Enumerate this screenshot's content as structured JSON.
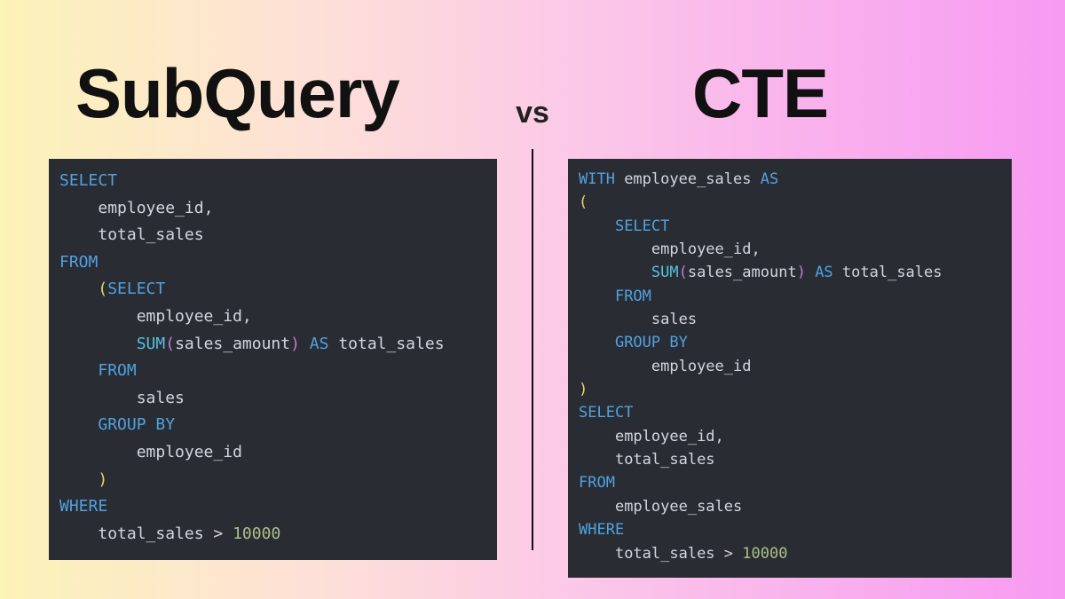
{
  "titles": {
    "left": "SubQuery",
    "right": "CTE",
    "vs": "vs"
  },
  "code": {
    "subquery": {
      "lines": [
        [
          {
            "c": "kw",
            "t": "SELECT"
          }
        ],
        [
          {
            "c": "guide",
            "t": "    "
          },
          {
            "c": "ident",
            "t": "employee_id,"
          }
        ],
        [
          {
            "c": "guide",
            "t": "    "
          },
          {
            "c": "ident",
            "t": "total_sales"
          }
        ],
        [
          {
            "c": "kw",
            "t": "FROM"
          }
        ],
        [
          {
            "c": "guide",
            "t": "    "
          },
          {
            "c": "paren-y",
            "t": "("
          },
          {
            "c": "kw",
            "t": "SELECT"
          }
        ],
        [
          {
            "c": "guide",
            "t": "        "
          },
          {
            "c": "ident",
            "t": "employee_id,"
          }
        ],
        [
          {
            "c": "guide",
            "t": "        "
          },
          {
            "c": "func",
            "t": "SUM"
          },
          {
            "c": "paren-p",
            "t": "("
          },
          {
            "c": "ident",
            "t": "sales_amount"
          },
          {
            "c": "paren-p",
            "t": ")"
          },
          {
            "c": "ident",
            "t": " "
          },
          {
            "c": "kw",
            "t": "AS"
          },
          {
            "c": "ident",
            "t": " total_sales"
          }
        ],
        [
          {
            "c": "guide",
            "t": "    "
          },
          {
            "c": "kw",
            "t": "FROM"
          }
        ],
        [
          {
            "c": "guide",
            "t": "        "
          },
          {
            "c": "ident",
            "t": "sales"
          }
        ],
        [
          {
            "c": "guide",
            "t": "    "
          },
          {
            "c": "kw",
            "t": "GROUP BY"
          }
        ],
        [
          {
            "c": "guide",
            "t": "        "
          },
          {
            "c": "ident",
            "t": "employee_id"
          }
        ],
        [
          {
            "c": "guide",
            "t": "    "
          },
          {
            "c": "paren-y",
            "t": ")"
          }
        ],
        [
          {
            "c": "kw",
            "t": "WHERE"
          }
        ],
        [
          {
            "c": "guide",
            "t": "    "
          },
          {
            "c": "ident",
            "t": "total_sales "
          },
          {
            "c": "op",
            "t": ">"
          },
          {
            "c": "ident",
            "t": " "
          },
          {
            "c": "num",
            "t": "10000"
          }
        ]
      ]
    },
    "cte": {
      "lines": [
        [
          {
            "c": "kw",
            "t": "WITH"
          },
          {
            "c": "ident",
            "t": " employee_sales "
          },
          {
            "c": "kw",
            "t": "AS"
          }
        ],
        [
          {
            "c": "paren-y",
            "t": "("
          }
        ],
        [
          {
            "c": "guide",
            "t": "    "
          },
          {
            "c": "kw",
            "t": "SELECT"
          }
        ],
        [
          {
            "c": "guide",
            "t": "        "
          },
          {
            "c": "ident",
            "t": "employee_id,"
          }
        ],
        [
          {
            "c": "guide",
            "t": "        "
          },
          {
            "c": "func",
            "t": "SUM"
          },
          {
            "c": "paren-p",
            "t": "("
          },
          {
            "c": "ident",
            "t": "sales_amount"
          },
          {
            "c": "paren-p",
            "t": ")"
          },
          {
            "c": "ident",
            "t": " "
          },
          {
            "c": "kw",
            "t": "AS"
          },
          {
            "c": "ident",
            "t": " total_sales"
          }
        ],
        [
          {
            "c": "guide",
            "t": "    "
          },
          {
            "c": "kw",
            "t": "FROM"
          }
        ],
        [
          {
            "c": "guide",
            "t": "        "
          },
          {
            "c": "ident",
            "t": "sales"
          }
        ],
        [
          {
            "c": "guide",
            "t": "    "
          },
          {
            "c": "kw",
            "t": "GROUP BY"
          }
        ],
        [
          {
            "c": "guide",
            "t": "        "
          },
          {
            "c": "ident",
            "t": "employee_id"
          }
        ],
        [
          {
            "c": "paren-y",
            "t": ")"
          }
        ],
        [
          {
            "c": "kw",
            "t": "SELECT"
          }
        ],
        [
          {
            "c": "guide",
            "t": "    "
          },
          {
            "c": "ident",
            "t": "employee_id,"
          }
        ],
        [
          {
            "c": "guide",
            "t": "    "
          },
          {
            "c": "ident",
            "t": "total_sales"
          }
        ],
        [
          {
            "c": "kw",
            "t": "FROM"
          }
        ],
        [
          {
            "c": "guide",
            "t": "    "
          },
          {
            "c": "ident",
            "t": "employee_sales"
          }
        ],
        [
          {
            "c": "kw",
            "t": "WHERE"
          }
        ],
        [
          {
            "c": "guide",
            "t": "    "
          },
          {
            "c": "ident",
            "t": "total_sales "
          },
          {
            "c": "op",
            "t": ">"
          },
          {
            "c": "ident",
            "t": " "
          },
          {
            "c": "num",
            "t": "10000"
          }
        ]
      ]
    }
  }
}
